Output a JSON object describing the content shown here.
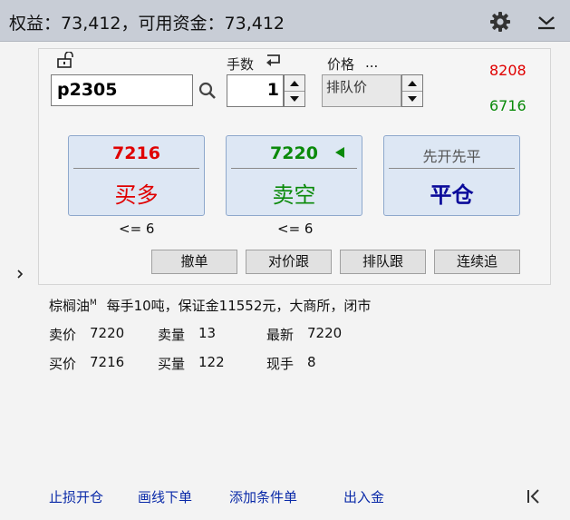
{
  "header": {
    "equity_label": "权益：",
    "equity_value": "73,412",
    "available_label": "，可用资金：",
    "available_value": "73,412",
    "icons": [
      "gear-icon",
      "chevron-down-icon"
    ]
  },
  "order": {
    "contract_code": "p2305",
    "quantity_label": "手数",
    "quantity": "1",
    "price_label": "价格",
    "price_more": "...",
    "price_mode": "排队价",
    "upper_price": "8208",
    "lower_price": "6716"
  },
  "trade_buttons": {
    "buy": {
      "price": "7216",
      "label": "买多",
      "limit": "<= 6"
    },
    "sell": {
      "price": "7220",
      "label": "卖空",
      "limit": "<= 6"
    },
    "close": {
      "mode": "先开先平",
      "label": "平仓"
    }
  },
  "actions": [
    "撤单",
    "对价跟",
    "排队跟",
    "连续追"
  ],
  "info": {
    "name": "棕榈油",
    "name_sup": "M",
    "details": "每手10吨，保证金11552元，大商所，闭市",
    "ask_price_label": "卖价",
    "ask_price": "7220",
    "ask_vol_label": "卖量",
    "ask_vol": "13",
    "last_label": "最新",
    "last": "7220",
    "bid_price_label": "买价",
    "bid_price": "7216",
    "bid_vol_label": "买量",
    "bid_vol": "122",
    "current_label": "现手",
    "current": "8"
  },
  "footer": {
    "links": [
      "止损开仓",
      "画线下单",
      "添加条件单",
      "出入金"
    ]
  },
  "colors": {
    "up": "#e00000",
    "down": "#0a8a0a",
    "link": "#0a2aa8",
    "close_action": "#0a0a9a"
  }
}
